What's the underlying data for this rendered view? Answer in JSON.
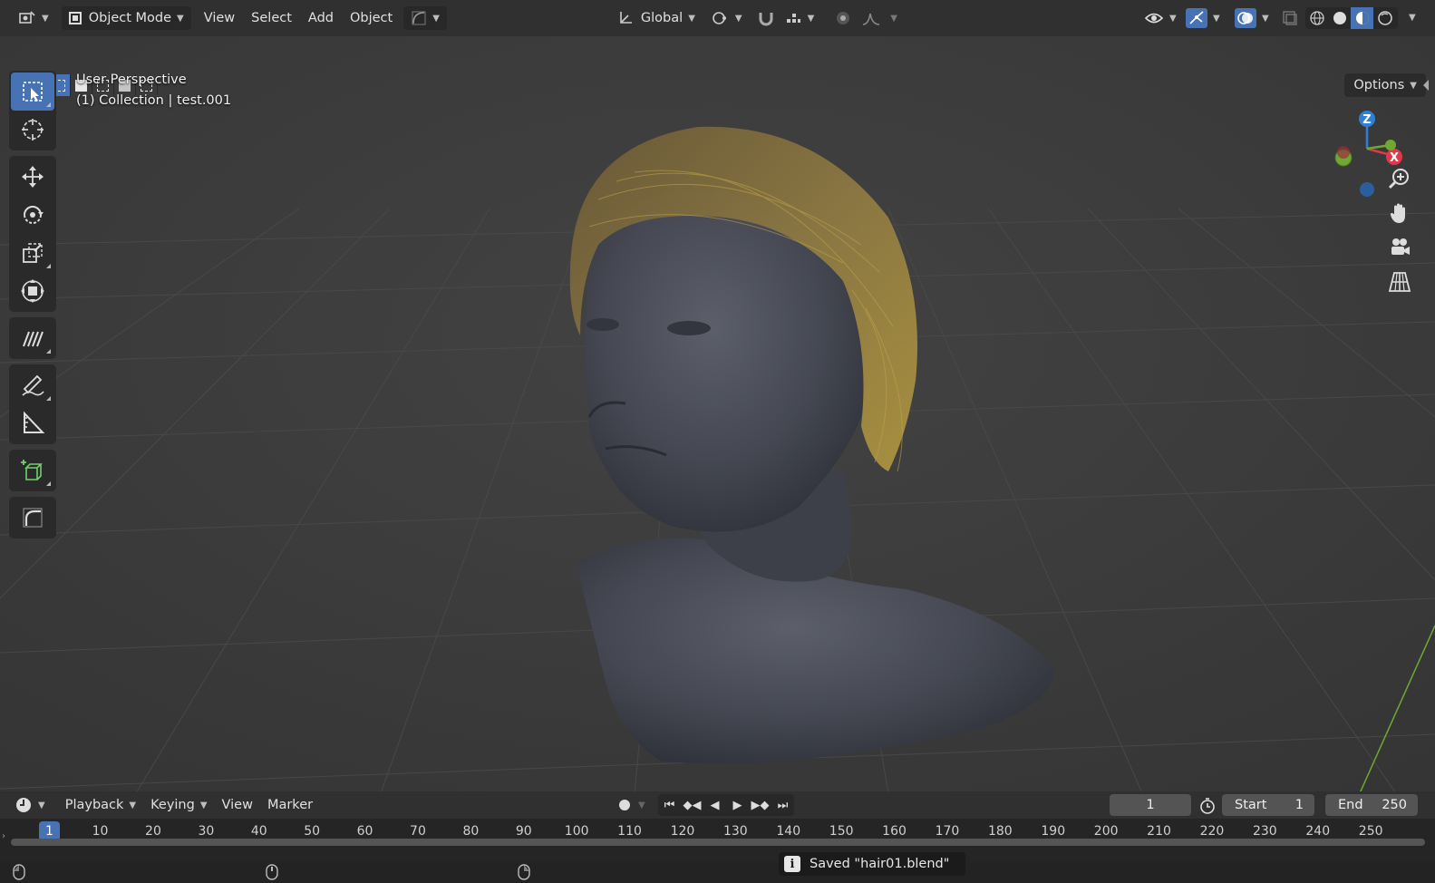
{
  "header": {
    "editor_icon": "editor-type-icon",
    "mode_label": "Object Mode",
    "menu": [
      "View",
      "Select",
      "Add",
      "Object"
    ],
    "transform_orientation": "Global"
  },
  "viewport": {
    "perspective_label": "User Perspective",
    "collection_label": "(1) Collection | test.001",
    "options_label": "Options",
    "gizmo": {
      "z": "Z",
      "x": "X"
    }
  },
  "timeline": {
    "menu": [
      "Playback",
      "Keying",
      "View",
      "Marker"
    ],
    "current_frame": "1",
    "start_label": "Start",
    "start_value": "1",
    "end_label": "End",
    "end_value": "250",
    "ticks": [
      "10",
      "20",
      "30",
      "40",
      "50",
      "60",
      "70",
      "80",
      "90",
      "100",
      "110",
      "120",
      "130",
      "140",
      "150",
      "160",
      "170",
      "180",
      "190",
      "200",
      "210",
      "220",
      "230",
      "240",
      "250"
    ],
    "cursor_frame": "1"
  },
  "status": {
    "message": "Saved \"hair01.blend\""
  },
  "colors": {
    "accent": "#4772b3",
    "header_bg": "#303030",
    "viewport_bg": "#3d3d3d",
    "axis_x": "#e0394a",
    "axis_y": "#6fa832",
    "axis_z": "#2f7fd6"
  }
}
